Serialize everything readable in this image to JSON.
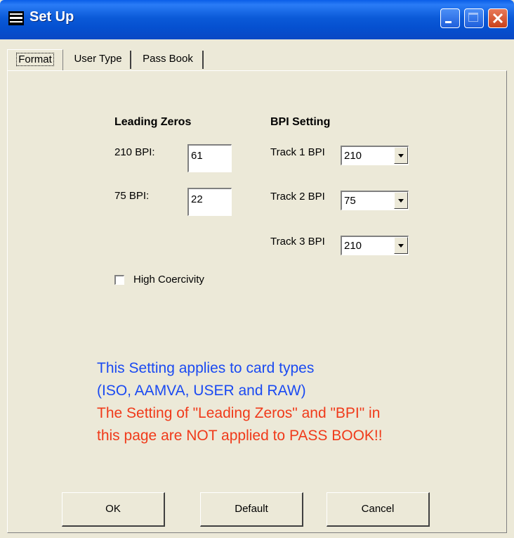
{
  "window": {
    "title": "Set Up"
  },
  "tabs": [
    {
      "label": "Format",
      "active": true
    },
    {
      "label": "User Type",
      "active": false
    },
    {
      "label": "Pass Book",
      "active": false
    }
  ],
  "leading_zeros": {
    "heading": "Leading Zeros",
    "fields": [
      {
        "label": "210 BPI:",
        "value": "61"
      },
      {
        "label": "75 BPI:",
        "value": "22"
      }
    ]
  },
  "bpi_setting": {
    "heading": "BPI Setting",
    "tracks": [
      {
        "label": "Track 1 BPI",
        "value": "210"
      },
      {
        "label": "Track 2 BPI",
        "value": "75"
      },
      {
        "label": "Track 3 BPI",
        "value": "210"
      }
    ]
  },
  "high_coercivity": {
    "label": "High Coercivity",
    "checked": false
  },
  "info": {
    "blue_lines": [
      "This Setting applies to card types",
      "(ISO, AAMVA, USER and RAW)"
    ],
    "red_lines": [
      "The Setting of \"Leading Zeros\" and \"BPI\" in",
      "this page are NOT applied to PASS BOOK!!"
    ],
    "blue_color": "#1a4af2",
    "red_color": "#f03a1a"
  },
  "buttons": {
    "ok": "OK",
    "default": "Default",
    "cancel": "Cancel"
  },
  "icons": {
    "app": "app-window-icon",
    "minimize": "minimize-icon",
    "maximize": "maximize-icon",
    "close": "close-icon"
  }
}
